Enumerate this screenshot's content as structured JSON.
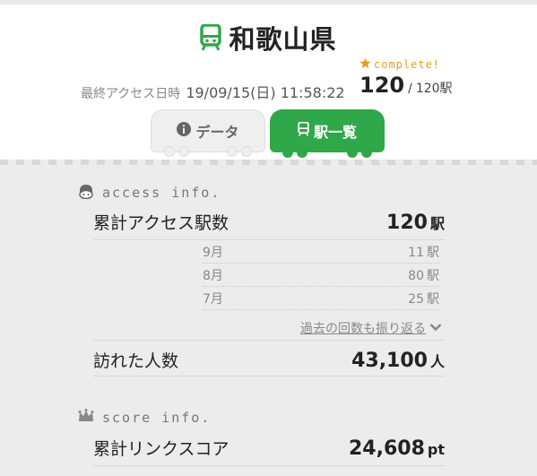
{
  "header": {
    "prefecture": "和歌山県",
    "last_access_label": "最終アクセス日時",
    "last_access_value": "19/09/15(日) 11:58:22",
    "complete_label": "complete!",
    "complete_count": "120",
    "complete_separator": "/",
    "complete_total": "120駅"
  },
  "tabs": [
    {
      "label": "データ",
      "active": false
    },
    {
      "label": "駅一覧",
      "active": true
    }
  ],
  "access_info": {
    "heading": "access info.",
    "total_label": "累計アクセス駅数",
    "total_value": "120",
    "total_unit": "駅",
    "months": [
      {
        "month": "9月",
        "value": "11",
        "unit": "駅"
      },
      {
        "month": "8月",
        "value": "80",
        "unit": "駅"
      },
      {
        "month": "7月",
        "value": "25",
        "unit": "駅"
      }
    ],
    "look_back_label": "過去の回数も振り返る",
    "visitors_label": "訪れた人数",
    "visitors_value": "43,100",
    "visitors_unit": "人"
  },
  "score_info": {
    "heading": "score info.",
    "link_score_label": "累計リンクスコア",
    "link_score_value": "24,608",
    "link_score_unit": "pt"
  },
  "colors": {
    "brand_green": "#2fa84a",
    "complete_orange": "#e59b1c",
    "background": "#ececec"
  },
  "icons": {
    "title": "train-icon",
    "tab_data": "info-icon",
    "tab_list": "train-icon",
    "access": "character-icon",
    "score": "crown-icon",
    "complete": "star-icon",
    "look_back": "chevron-down-icon"
  }
}
